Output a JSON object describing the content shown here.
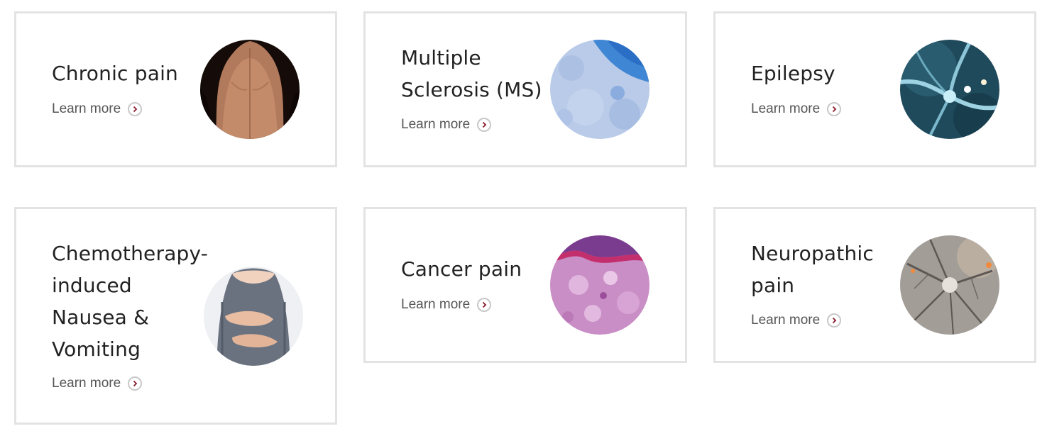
{
  "cards": [
    {
      "title_lines": [
        "Chronic pain"
      ],
      "link_label": "Learn more",
      "image": "bare-back-photo"
    },
    {
      "title_lines": [
        "Multiple",
        "Sclerosis (MS)"
      ],
      "link_label": "Learn more",
      "image": "blue-tissue-micrograph"
    },
    {
      "title_lines": [
        "Epilepsy"
      ],
      "link_label": "Learn more",
      "image": "neuron-network-render"
    },
    {
      "title_lines": [
        "Chemotherapy-",
        "induced",
        "Nausea &",
        "Vomiting"
      ],
      "link_label": "Learn more",
      "image": "stomach-ache-photo"
    },
    {
      "title_lines": [
        "Cancer pain"
      ],
      "link_label": "Learn more",
      "image": "pink-histology-micrograph"
    },
    {
      "title_lines": [
        "Neuropathic",
        "pain"
      ],
      "link_label": "Learn more",
      "image": "nerve-cell-render"
    }
  ],
  "icons": {
    "link_chevron": "chevron-right-icon"
  },
  "colors": {
    "card_border": "#e3e3e3",
    "title_text": "#222222",
    "link_text": "#555555",
    "chevron_accent": "#8b1a2b"
  }
}
